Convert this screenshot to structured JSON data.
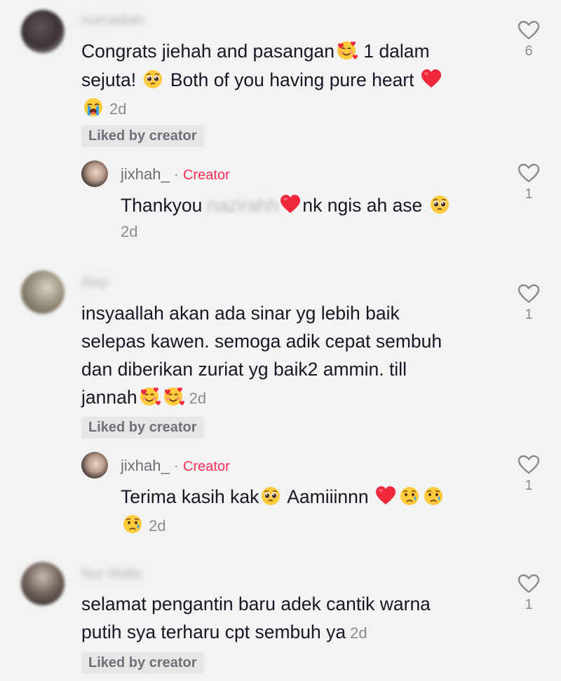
{
  "comments": [
    {
      "username": "nurnadiah",
      "text_part1": "Congrats jiehah and pasangan",
      "text_part2": " 1 dalam",
      "text_line2_a": "sejuta! ",
      "text_line2_b": " Both of you having pure heart ",
      "time": "2d",
      "liked_badge": "Liked by creator",
      "likes": "6",
      "reply": {
        "username": "jixhah_",
        "creator_tag": "Creator",
        "text_a": "Thankyou ",
        "blurred_mention": "nazirahh",
        "text_b": "nk ngis ah ase ",
        "time": "2d",
        "likes": "1"
      }
    },
    {
      "username": "Aisy",
      "line1": "insyaallah akan ada sinar yg lebih baik",
      "line2": "selepas kawen. semoga adik cepat sembuh",
      "line3": "dan diberikan zuriat yg baik2 ammin. till",
      "line4": "jannah",
      "time": "2d",
      "liked_badge": "Liked by creator",
      "likes": "1",
      "reply": {
        "username": "jixhah_",
        "creator_tag": "Creator",
        "text_a": "Terima kasih kak",
        "text_b": " Aamiiinnn ",
        "time": "2d",
        "likes": "1"
      }
    },
    {
      "username": "Nur Malia",
      "line1": "selamat pengantin baru adek cantik warna",
      "line2": "putih sya terharu cpt sembuh ya",
      "time": "2d",
      "liked_badge": "Liked by creator",
      "likes": "1"
    }
  ],
  "icons": {
    "like": "heart-outline-icon",
    "smiling_hearts": "smiling-face-with-hearts-emoji",
    "pleading": "pleading-face-emoji",
    "red_heart": "red-heart-emoji",
    "crying": "loudly-crying-face-emoji",
    "sad_tear": "crying-face-emoji"
  },
  "colors": {
    "background": "#f3f3f3",
    "creator": "#fe2c55",
    "muted": "#8a8b91",
    "badge_bg": "#e6e6e7"
  }
}
